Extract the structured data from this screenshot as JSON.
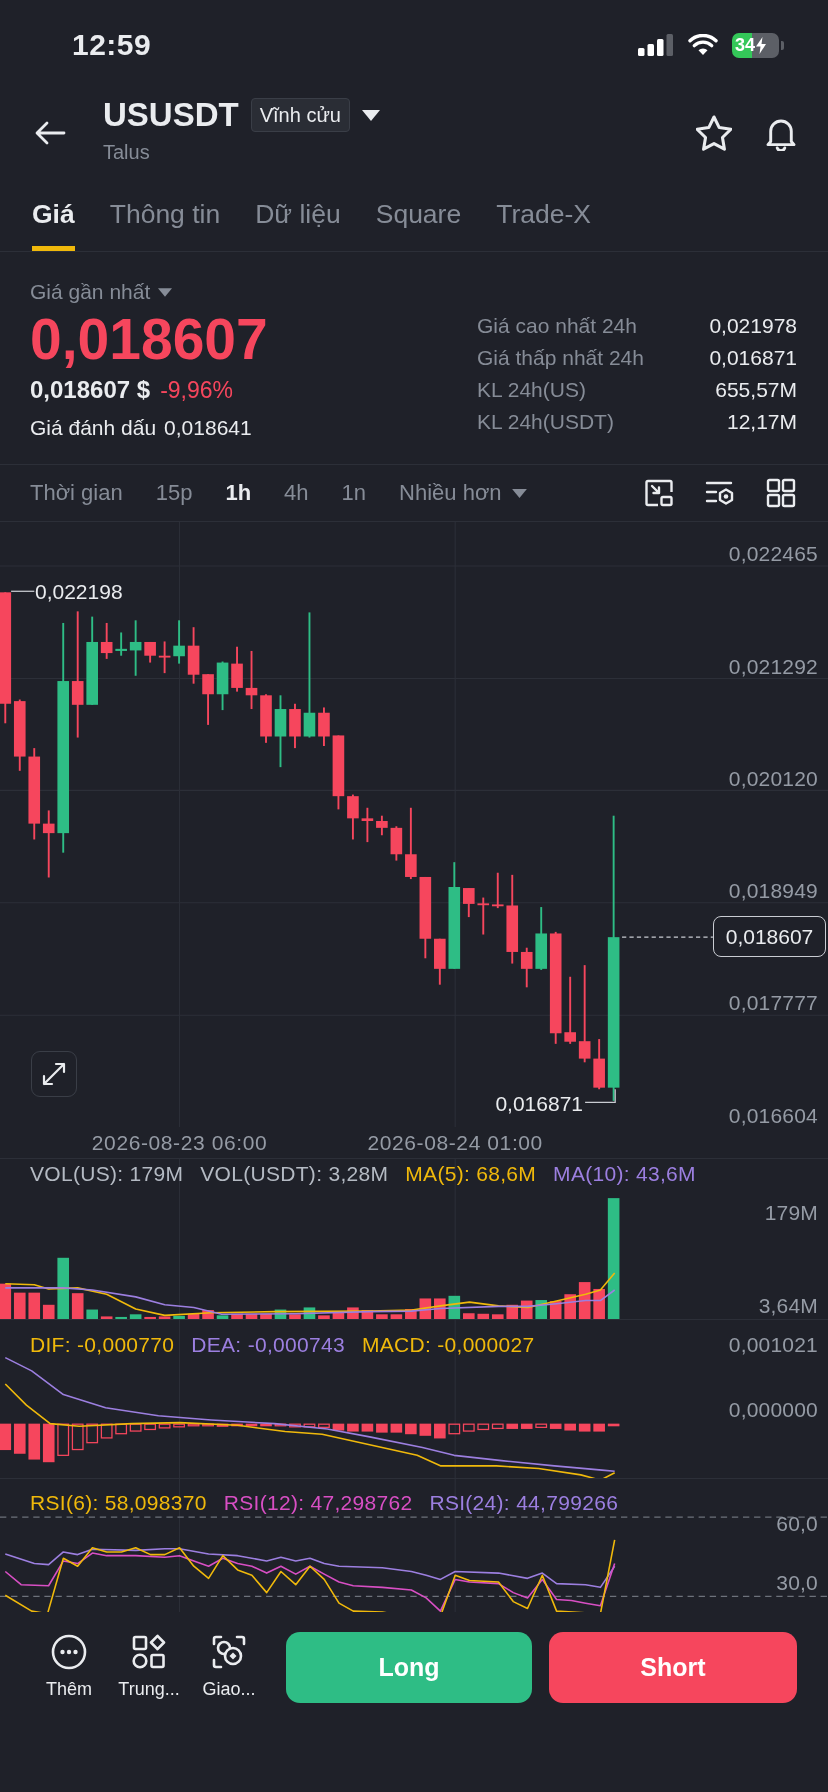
{
  "status_bar": {
    "time": "12:59",
    "battery": "34"
  },
  "header": {
    "symbol": "USUSDT",
    "contract_type": "Vĩnh cửu",
    "subtitle": "Talus"
  },
  "tabs": [
    {
      "label": "Giá",
      "selected": true
    },
    {
      "label": "Thông tin",
      "selected": false
    },
    {
      "label": "Dữ liệu",
      "selected": false
    },
    {
      "label": "Square",
      "selected": false
    },
    {
      "label": "Trade-X",
      "selected": false
    }
  ],
  "price": {
    "label": "Giá gần nhất",
    "last": "0,018607",
    "usd_value": "0,018607 $",
    "change": "-9,96%",
    "mark_label": "Giá đánh dấu",
    "mark_value": "0,018641"
  },
  "stats": [
    {
      "label": "Giá cao nhất 24h",
      "value": "0,021978"
    },
    {
      "label": "Giá thấp nhất 24h",
      "value": "0,016871"
    },
    {
      "label": "KL 24h(US)",
      "value": "655,57M"
    },
    {
      "label": "KL 24h(USDT)",
      "value": "12,17M"
    }
  ],
  "toolbar": {
    "label": "Thời gian",
    "intervals": [
      {
        "label": "15p",
        "selected": false
      },
      {
        "label": "1h",
        "selected": true
      },
      {
        "label": "4h",
        "selected": false
      },
      {
        "label": "1n",
        "selected": false
      }
    ],
    "more": "Nhiều hơn"
  },
  "chart": {
    "price_axis": [
      "0,022465",
      "0,021292",
      "0,020120",
      "0,018949",
      "0,017777",
      "0,016604"
    ],
    "high_label": "0,022198",
    "low_label": "0,016871",
    "last_price": "0,018607",
    "time_axis": [
      "2026-08-23 06:00",
      "2026-08-24 01:00"
    ]
  },
  "volume": {
    "legend": [
      {
        "text": "VOL(US): 179M",
        "color": "#b4bac3"
      },
      {
        "text": "VOL(USDT): 3,28M",
        "color": "#b4bac3"
      },
      {
        "text": "MA(5): 68,6M",
        "color": "#f0b90b"
      },
      {
        "text": "MA(10): 43,6M",
        "color": "#9c7fe0"
      }
    ],
    "axis": [
      "179M",
      "3,64M"
    ]
  },
  "macd": {
    "legend": [
      {
        "text": "DIF: -0,000770",
        "color": "#f0b90b"
      },
      {
        "text": "DEA: -0,000743",
        "color": "#9c7fe0"
      },
      {
        "text": "MACD: -0,000027",
        "color": "#f0b90b"
      }
    ],
    "axis": [
      "0,001021",
      "0,000000"
    ]
  },
  "rsi": {
    "legend": [
      {
        "text": "RSI(6): 58,098370",
        "color": "#f0b90b"
      },
      {
        "text": "RSI(12): 47,298762",
        "color": "#d84fc4"
      },
      {
        "text": "RSI(24): 44,799266",
        "color": "#9c7fe0"
      }
    ],
    "axis": [
      "60,0",
      "30,0"
    ]
  },
  "bottom_bar": {
    "actions": [
      {
        "label": "Thêm",
        "kind": "more"
      },
      {
        "label": "Trung...",
        "kind": "shapes"
      },
      {
        "label": "Giao...",
        "kind": "scan"
      }
    ],
    "long": "Long",
    "short": "Short"
  }
}
